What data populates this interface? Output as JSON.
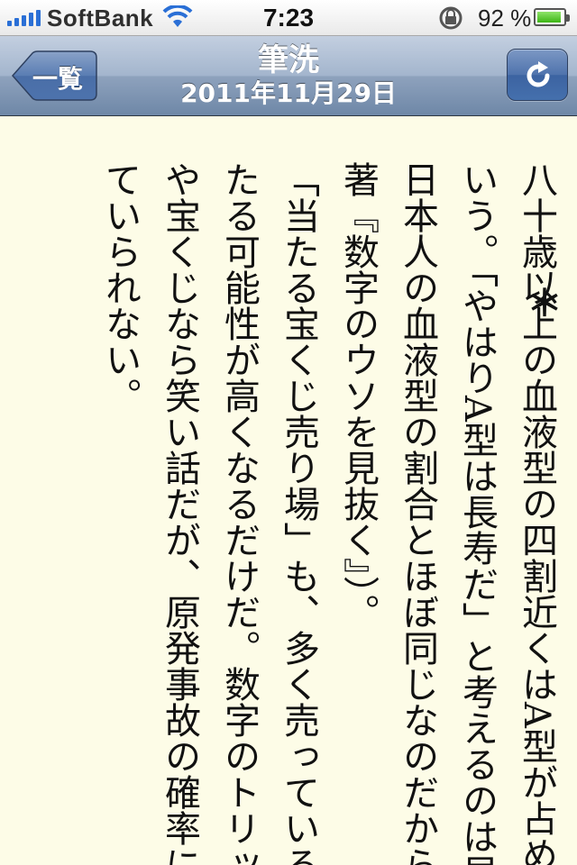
{
  "status_bar": {
    "carrier": "SoftBank",
    "time": "7:23",
    "battery_percent": "92 %",
    "battery_level": 0.92,
    "icons": [
      "signal-icon",
      "wifi-icon",
      "rotation-lock-icon",
      "battery-icon"
    ]
  },
  "nav": {
    "back_label": "一覧",
    "title": "筆洗",
    "date": "2011年11月29日",
    "refresh_icon": "refresh-icon",
    "colors": {
      "bar": "#8ea2bd",
      "button": "#4570ad"
    }
  },
  "article": {
    "columns": [
      "八十歳以上の血液型の四割近くはA型が占めていると",
      "いう。「やはりA型は長寿だ」と考えるのは早とちり。",
      "日本人の血液型の割合とほぼ同じなのだから（野口哲典",
      "著『数字のウソを見抜く』）。",
      "「当たる宝くじ売り場」も、多く売っている店ほど当",
      "たる可能性が高くなるだけだ。数字のトリックは血液型",
      "や宝くじなら笑い話だが、原発事故の確率になると笑っ",
      "ていられない。"
    ],
    "separator": "＊",
    "background": "#fdfce7"
  }
}
